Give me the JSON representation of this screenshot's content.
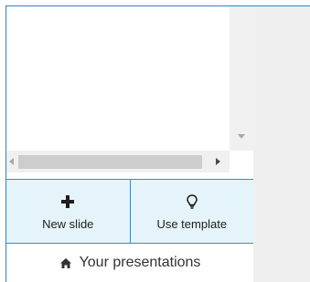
{
  "scrollbars": {
    "vertical": "vertical-scrollbar",
    "horizontal": "horizontal-scrollbar"
  },
  "actions": {
    "new_slide": {
      "label": "New slide",
      "icon": "plus-icon"
    },
    "use_template": {
      "label": "Use template",
      "icon": "lightbulb-icon"
    }
  },
  "presentations_link": {
    "label": "Your presentations",
    "icon": "home-icon"
  },
  "colors": {
    "accent_border": "#3c8dbc",
    "button_bg": "#e4f4fa"
  }
}
